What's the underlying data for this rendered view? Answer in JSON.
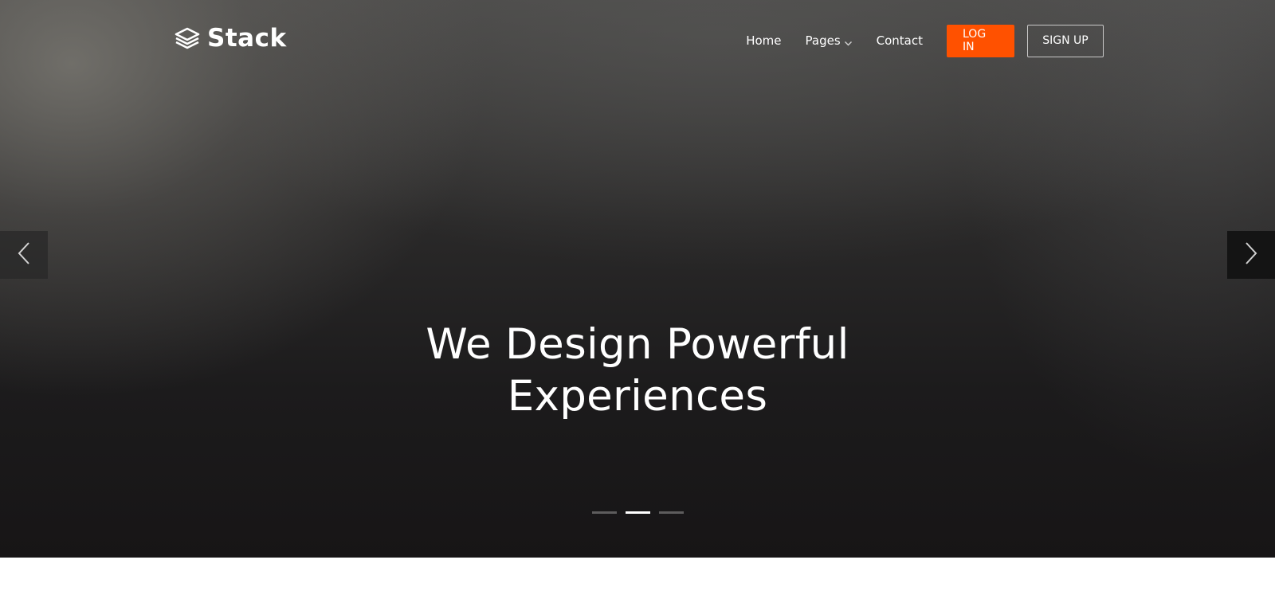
{
  "brand": {
    "name": "Stack",
    "icon": "layers-icon"
  },
  "nav": {
    "items": [
      {
        "label": "Home"
      },
      {
        "label": "Pages",
        "icon": "chevron-down-icon"
      },
      {
        "label": "Contact"
      }
    ],
    "login_label": "LOG IN",
    "signup_label": "SIGN UP"
  },
  "hero": {
    "headline_line1": "We Design Powerful",
    "headline_line2": "Experiences",
    "prev_icon": "chevron-left-icon",
    "next_icon": "chevron-right-icon",
    "slides_total": 3,
    "active_slide": 2
  },
  "colors": {
    "accent": "#ff5100",
    "text": "#ffffff",
    "hero_dark": "#1c1b1c"
  }
}
